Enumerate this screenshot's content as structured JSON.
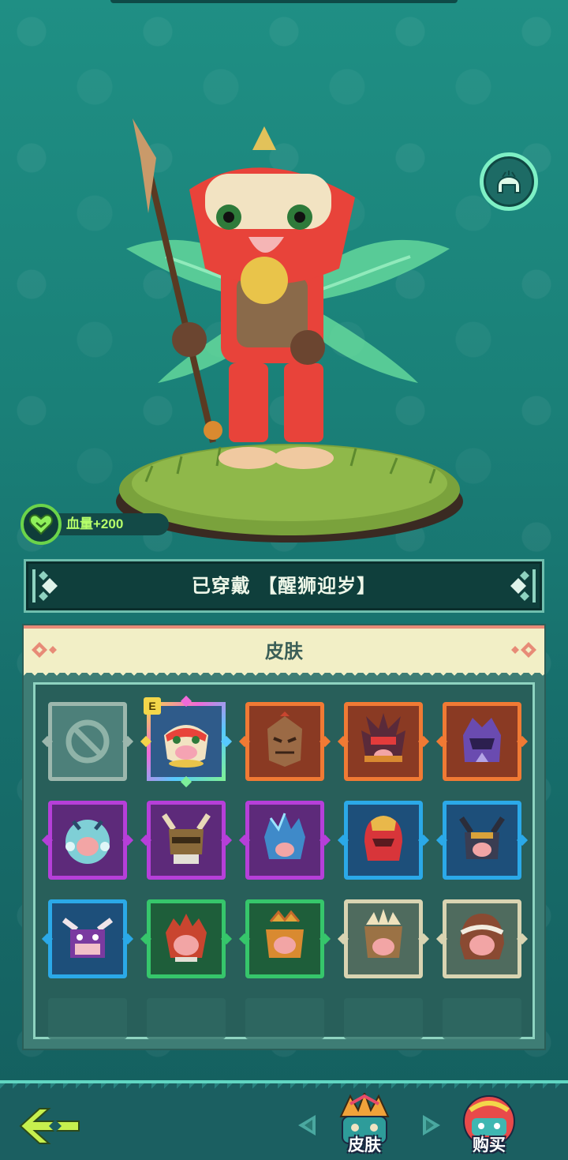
{
  "hero": {
    "stat_label": "血量+200"
  },
  "equipped": {
    "text": "已穿戴 【醒狮迎岁】"
  },
  "skins": {
    "title": "皮肤",
    "equipped_marker": "E",
    "slots": [
      {
        "icon": "none-slot-icon",
        "rarity": "none"
      },
      {
        "icon": "lion-dance-helmet-icon",
        "rarity": "rainbow"
      },
      {
        "icon": "wooden-mask-helmet-icon",
        "rarity": "orange"
      },
      {
        "icon": "spiked-demon-helmet-icon",
        "rarity": "orange"
      },
      {
        "icon": "purple-knight-helmet-icon",
        "rarity": "orange"
      },
      {
        "icon": "frost-beast-helmet-icon",
        "rarity": "purple"
      },
      {
        "icon": "horned-bronze-helmet-icon",
        "rarity": "purple"
      },
      {
        "icon": "crystal-helmet-icon",
        "rarity": "purple"
      },
      {
        "icon": "red-gold-helmet-icon",
        "rarity": "blue"
      },
      {
        "icon": "dark-horned-helmet-icon",
        "rarity": "blue"
      },
      {
        "icon": "purple-bull-helmet-icon",
        "rarity": "blue"
      },
      {
        "icon": "red-spiky-hair-icon",
        "rarity": "green"
      },
      {
        "icon": "leaf-crown-helmet-icon",
        "rarity": "green"
      },
      {
        "icon": "spiked-leather-helmet-icon",
        "rarity": "white"
      },
      {
        "icon": "brown-hood-icon",
        "rarity": "white"
      }
    ]
  },
  "bottom_nav": {
    "skins_label": "皮肤",
    "shop_label": "购买"
  },
  "colors": {
    "rainbow": "#c48cff",
    "orange": "#f07a34",
    "purple": "#b63fd9",
    "blue": "#2ba9e8",
    "green": "#36c66b",
    "white": "#d9d4b2",
    "none": "#9cb7ad"
  }
}
